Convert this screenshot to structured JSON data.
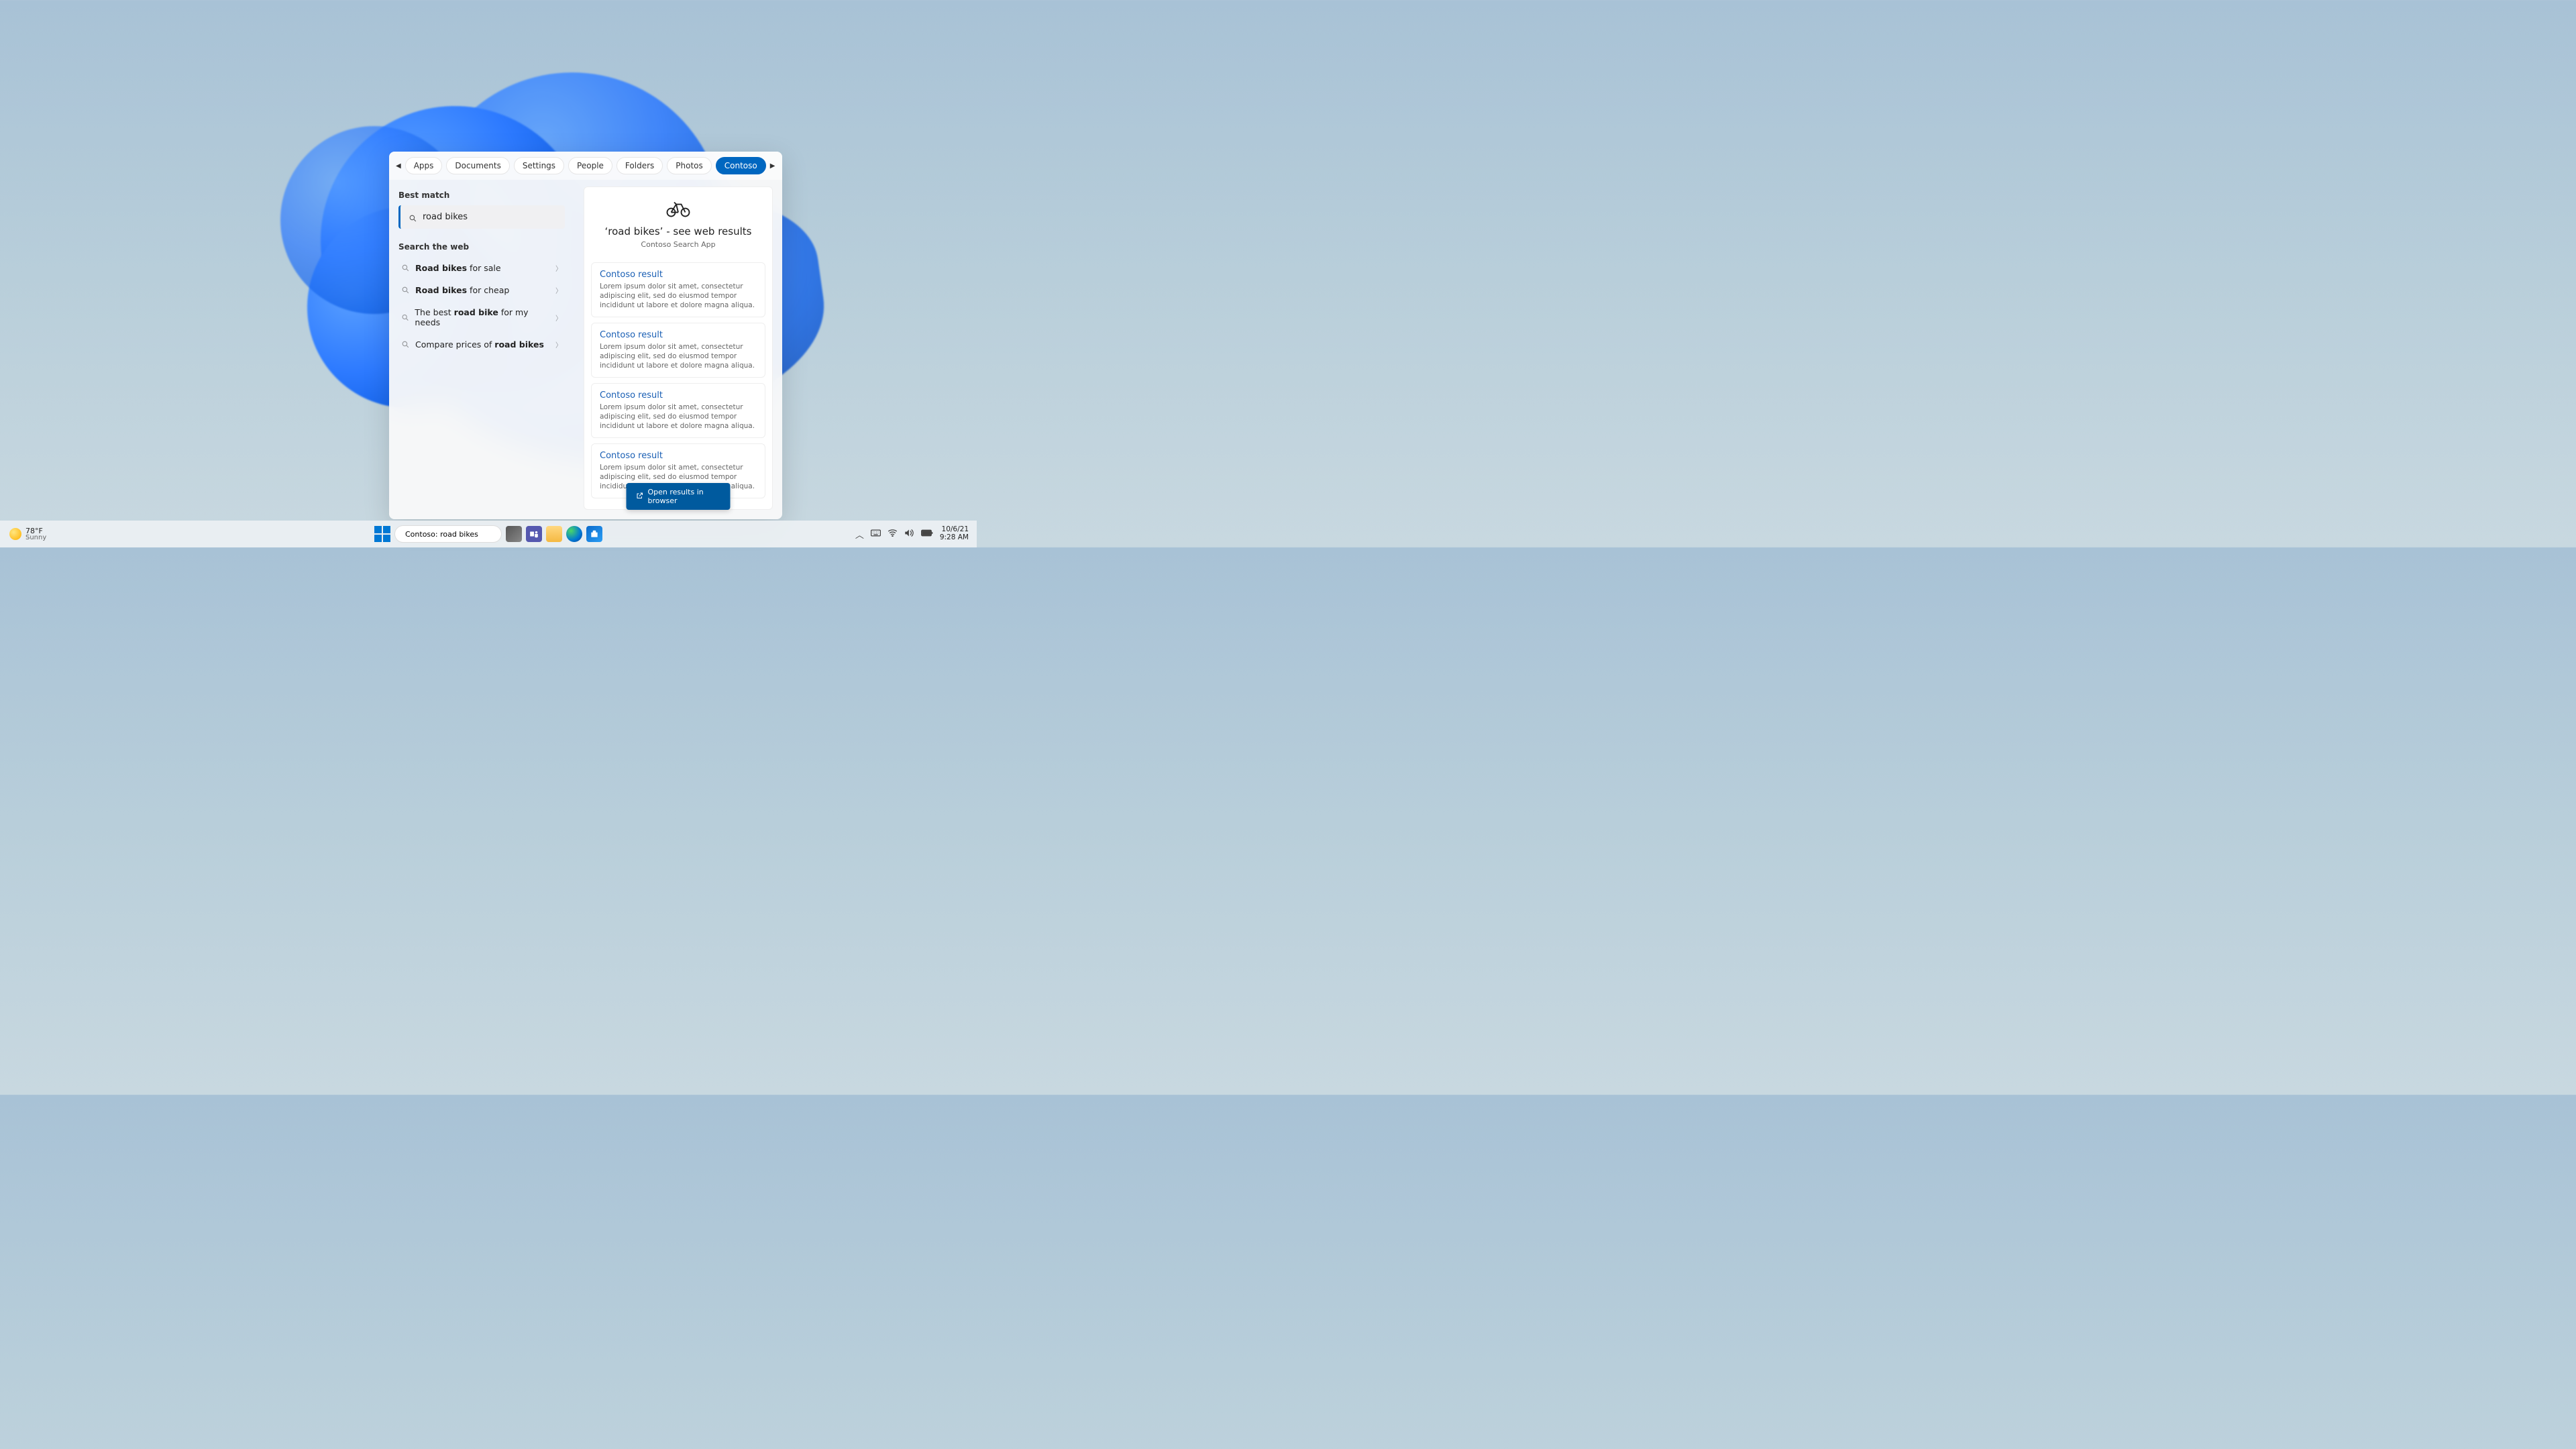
{
  "header": {
    "filters": [
      "Apps",
      "Documents",
      "Settings",
      "People",
      "Folders",
      "Photos",
      "Contoso"
    ],
    "active_filter": "Contoso"
  },
  "left": {
    "best_match_label": "Best match",
    "best_match_text": "road bikes",
    "search_web_label": "Search the web",
    "web_items": [
      {
        "pre": "",
        "bold": "Road bikes",
        "post": " for sale"
      },
      {
        "pre": "",
        "bold": "Road bikes",
        "post": " for cheap"
      },
      {
        "pre": "The best ",
        "bold": "road bike",
        "post": " for my needs"
      },
      {
        "pre": "Compare prices of ",
        "bold": "road bikes",
        "post": ""
      }
    ]
  },
  "preview": {
    "title": "‘road bikes’ - see web results",
    "subtitle": "Contoso Search App",
    "open_label": "Open results in browser",
    "results": [
      {
        "title": "Contoso result",
        "snippet": "Lorem ipsum dolor sit amet, consectetur adipiscing elit, sed do eiusmod tempor incididunt ut labore et dolore magna aliqua. Ut enim ad minim veniam, quis nostrud exercitation ullamco…"
      },
      {
        "title": "Contoso result",
        "snippet": "Lorem ipsum dolor sit amet, consectetur adipiscing elit, sed do eiusmod tempor incididunt ut labore et dolore magna aliqua. Ut enim ad minim veniam, quis nostrud exercitation ullamco…"
      },
      {
        "title": "Contoso result",
        "snippet": "Lorem ipsum dolor sit amet, consectetur adipiscing elit, sed do eiusmod tempor incididunt ut labore et dolore magna aliqua. Ut enim ad minim veniam, quis nostrud exercitation ullamco…"
      },
      {
        "title": "Contoso result",
        "snippet": "Lorem ipsum dolor sit amet, consectetur adipiscing elit, sed do eiusmod tempor incididunt ut labore et dolore magna aliqua. Ut enim ad minim veniam, quis nostrud exercitation ullamco…"
      }
    ]
  },
  "taskbar": {
    "weather_temp": "78°F",
    "weather_cond": "Sunny",
    "search_value": "Contoso: road bikes",
    "date": "10/6/21",
    "time": "9:28 AM"
  }
}
